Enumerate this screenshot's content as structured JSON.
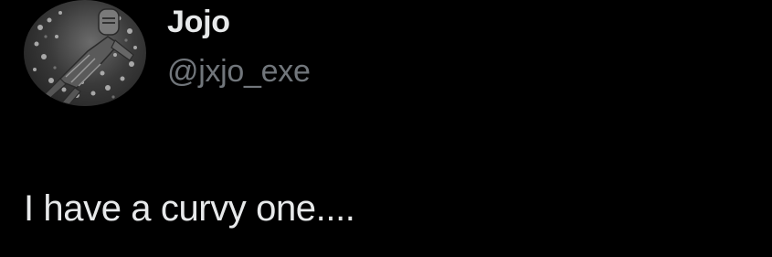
{
  "author": {
    "display_name": "Jojo",
    "handle": "@jxjo_exe",
    "avatar_icon": "knight-in-flowers-avatar"
  },
  "tweet": {
    "text": "I have a curvy one...."
  },
  "colors": {
    "background": "#000000",
    "primary_text": "#e7e9ea",
    "secondary_text": "#71767b"
  }
}
